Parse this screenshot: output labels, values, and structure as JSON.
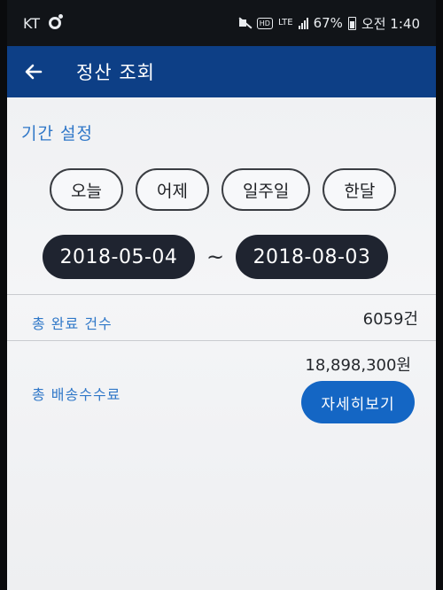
{
  "status_bar": {
    "carrier": "KT",
    "network": "LTE",
    "battery": "67%",
    "time": "오전 1:40"
  },
  "app_bar": {
    "title": "정산 조회"
  },
  "period": {
    "section_title": "기간 설정",
    "buttons": [
      "오늘",
      "어제",
      "일주일",
      "한달"
    ],
    "start_date": "2018-05-04",
    "separator": "~",
    "end_date": "2018-08-03"
  },
  "summary": {
    "completed_label": "총 완료 건수",
    "completed_value": "6059건",
    "fee_label": "총 배송수수료",
    "fee_value": "18,898,300원",
    "detail_button": "자세히보기"
  },
  "colors": {
    "app_bar": "#0d3f86",
    "accent_text": "#2f77c8",
    "primary_button": "#1466c4",
    "date_pill": "#1f2430"
  }
}
